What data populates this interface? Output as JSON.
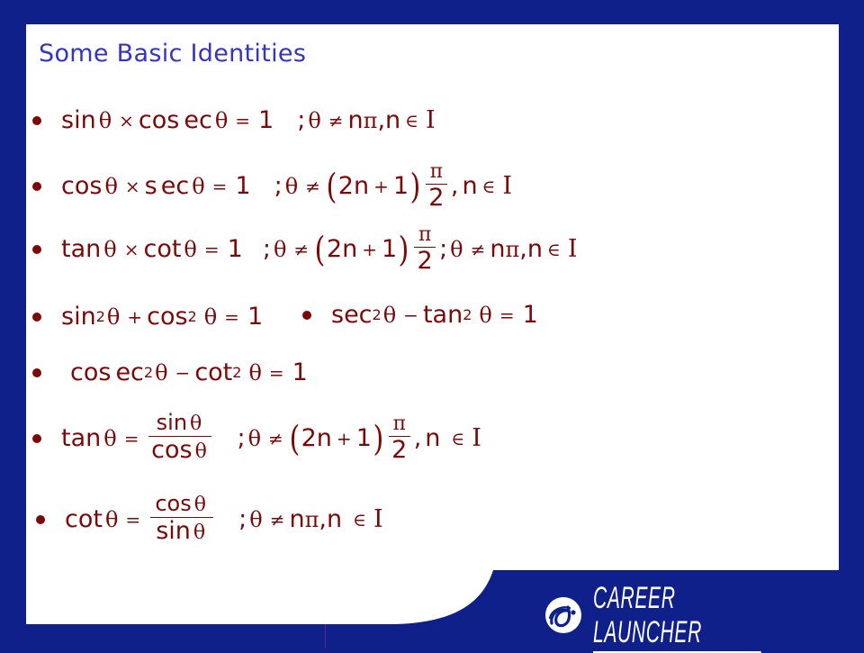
{
  "slide": {
    "title": "Some Basic Identities",
    "colors": {
      "frame": "#10208a",
      "title": "#3535c0",
      "formula": "#7a0a0a",
      "background": "#ffffff"
    }
  },
  "identities": [
    {
      "id": "reciprocal-sin-cosec",
      "lhs": [
        "sin",
        "θ",
        "×",
        "cos",
        "ec",
        "θ",
        "=",
        "1"
      ],
      "condition": ";θ ≠ nπ, n ∈ I",
      "text": "sinθ × cosecθ = 1 ; θ ≠ nπ, n ∈ I"
    },
    {
      "id": "reciprocal-cos-sec",
      "lhs": [
        "cos",
        "θ",
        "×",
        "s",
        "ec",
        "θ",
        "=",
        "1"
      ],
      "condition": ";θ ≠ (2n + 1)π/2, n ∈ I",
      "text": "cosθ × secθ = 1 ; θ ≠ (2n+1)π/2, n ∈ I"
    },
    {
      "id": "reciprocal-tan-cot",
      "lhs": [
        "tan",
        "θ",
        "×",
        "cot",
        "θ",
        "=",
        "1"
      ],
      "condition": ";θ ≠ (2n + 1)π/2; θ ≠ nπ, n ∈ I",
      "text": "tanθ × cotθ = 1 ; θ ≠ (2n+1)π/2 ; θ ≠ nπ, n ∈ I"
    },
    {
      "id": "pythagorean-sin-cos",
      "text": "sin²θ + cos²θ = 1"
    },
    {
      "id": "pythagorean-sec-tan",
      "text": "sec²θ − tan²θ = 1"
    },
    {
      "id": "pythagorean-cosec-cot",
      "text": "cosec²θ − cot²θ = 1"
    },
    {
      "id": "quotient-tan",
      "text": "tanθ = sinθ / cosθ ; θ ≠ (2n+1)π/2, n ∈ I"
    },
    {
      "id": "quotient-cot",
      "text": "cotθ = cosθ / sinθ ; θ ≠ nπ, n ∈ I"
    }
  ],
  "tokens": {
    "sin": "sin",
    "cos": "cos",
    "tan": "tan",
    "cot": "cot",
    "sec": "sec",
    "cosec_a": "cos",
    "cosec_b": "ec",
    "s": "s",
    "ec": "ec",
    "theta": "θ",
    "times": "×",
    "eq": "=",
    "one": "1",
    "plus": "+",
    "minus": "−",
    "neq": "≠",
    "semi": ";",
    "comma": ",",
    "n": "n",
    "pi": "π",
    "in": "∈",
    "I": "I",
    "two": "2",
    "sq": "2",
    "lparen": "(",
    "rparen": ")",
    "twon": "2n",
    "npi": "nπ"
  },
  "footer": {
    "brand": "CAREER LAUNCHER",
    "logo_icon": "career-launcher-swoosh-icon"
  }
}
